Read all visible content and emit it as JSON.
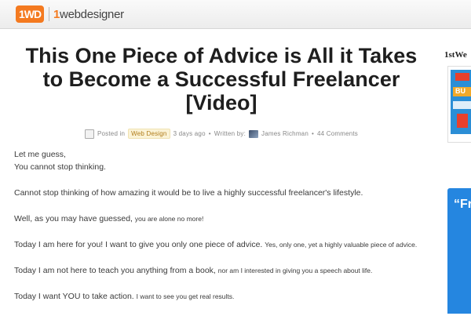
{
  "header": {
    "logo_mark": "1WD",
    "logo_text_first": "1",
    "logo_text_rest": "webdesigner"
  },
  "article": {
    "title": "This One Piece of Advice is All it Takes to Become a Successful Freelancer [Video]",
    "meta": {
      "posted_in": "Posted in",
      "category": "Web Design",
      "age": "3 days ago",
      "bullet": "•",
      "written_by": "Written by:",
      "author": "James Richman",
      "comments": "44 Comments"
    },
    "paragraphs": [
      {
        "a": "Let me guess,",
        "b": "You cannot stop thinking."
      },
      {
        "a": "Cannot stop thinking of how amazing it would be to live a highly successful freelancer's lifestyle."
      },
      {
        "a": "Well, as you may have guessed,",
        "b": "you are alone no more!"
      },
      {
        "a": "Today I am here for you! I want to give you only one piece of advice.",
        "b": "Yes, only one, yet a highly valuable piece of advice."
      },
      {
        "a": "Today I am not here to teach you anything from a book,",
        "b": "nor am I interested in giving you a speech about life."
      },
      {
        "a": "Today I want YOU to take action.",
        "b": "I want to see you get real results."
      }
    ]
  },
  "sidebar": {
    "heading": "1stWe",
    "ad_text": "BU",
    "quote_mark": "“Fr"
  },
  "colors": {
    "brand_orange": "#f47a20",
    "sidebar_blue": "#2586e0",
    "category_bg": "#fbf3d6"
  }
}
